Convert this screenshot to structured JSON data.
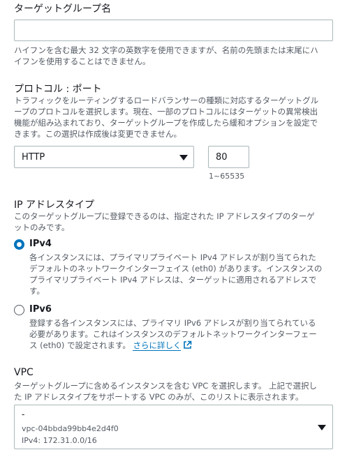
{
  "target_group_name": {
    "label": "ターゲットグループ名",
    "value": "",
    "hint_lines": [
      "ハイフンを含む最大 32 文字の英数字を使用できますが、名前の先頭または末尾にハ",
      "イフンを使用することはできません。"
    ]
  },
  "protocol_port": {
    "label": "プロトコル : ポート",
    "desc_lines": [
      "トラフィックをルーティングするロードバランサーの種類に対応するターゲットグル",
      "ープのプロトコルを選択します。現在、一部のプロトコルにはターゲットの異常検出",
      "機能が組み込まれており、ターゲットグループを作成したら緩和オプションを設定で",
      "きます。この選択は作成後は変更できません。"
    ],
    "protocol_selected": "HTTP",
    "port_value": "80",
    "port_hint": "1~65535"
  },
  "ip_address_type": {
    "label": "IP アドレスタイプ",
    "desc_lines": [
      "このターゲットグループに登録できるのは、指定された IP アドレスタイプのターゲ",
      "ットのみです。"
    ],
    "options": [
      {
        "label": "IPv4",
        "selected": true,
        "desc_lines": [
          "各インスタンスには、プライマリプライベート IPv4 アドレスが割り当てられた",
          "デフォルトのネットワークインターフェイス (eth0) があります。インスタンスの",
          "プライマリプライベート IPv4 アドレスは、ターゲットに適用されるアドレスで",
          "す。"
        ]
      },
      {
        "label": "IPv6",
        "selected": false,
        "desc_lines": [
          "登録する各インスタンスには、プライマリ IPv6 アドレスが割り当てられている",
          "必要があります。これはインスタンスのデフォルトネットワークインターフェー",
          "ス (eth0) で設定されます。"
        ],
        "link_text": "さらに詳しく"
      }
    ]
  },
  "vpc": {
    "label": "VPC",
    "desc_lines": [
      "ターゲットグループに含めるインスタンスを含む VPC を選択します。 上記で選択し",
      "た IP アドレスタイプをサポートする VPC のみが、このリストに表示されます。"
    ],
    "selected_name": "-",
    "selected_id": "vpc-04bbda99bb4e2d4f0",
    "selected_cidr": "IPv4: 172.31.0.0/16"
  },
  "colors": {
    "accent": "#0073bb",
    "text": "#16191f",
    "secondary_text": "#545b64",
    "border": "#aab7b8"
  },
  "icons": [
    "caret-down-icon",
    "external-link-icon",
    "radio-icon"
  ]
}
